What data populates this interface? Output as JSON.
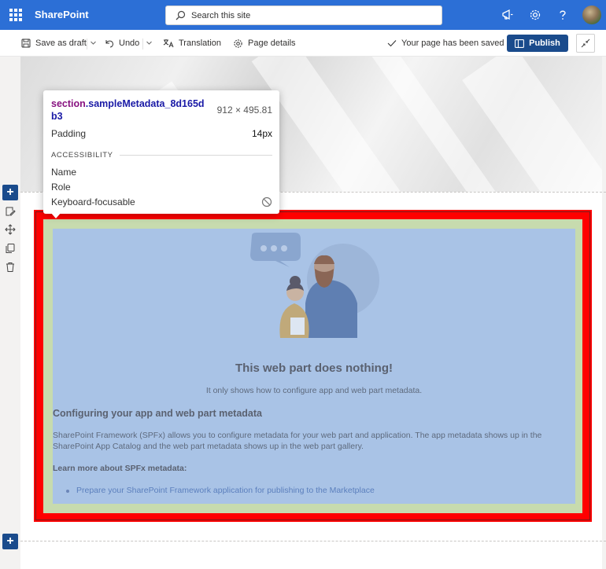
{
  "suite": {
    "app_name": "SharePoint",
    "search_placeholder": "Search this site"
  },
  "commands": {
    "save_draft": "Save as draft",
    "undo": "Undo",
    "translation": "Translation",
    "page_details": "Page details",
    "saved_status": "Your page has been saved",
    "publish": "Publish"
  },
  "tooltip": {
    "selector_tag": "section",
    "selector_class": ".sampleMetadata_8d165db3",
    "size": "912 × 495.81",
    "padding_label": "Padding",
    "padding_value": "14px",
    "section_title": "ACCESSIBILITY",
    "name_label": "Name",
    "role_label": "Role",
    "keyboard_label": "Keyboard-focusable"
  },
  "webpart": {
    "title": "This web part does nothing!",
    "subtitle": "It only shows how to configure app and web part metadata.",
    "heading": "Configuring your app and web part metadata",
    "paragraph": "SharePoint Framework (SPFx) allows you to configure metadata for your web part and application. The app metadata shows up in the SharePoint App Catalog and the web part metadata shows up in the web part gallery.",
    "learn_more": "Learn more about SPFx metadata:",
    "link": "Prepare your SharePoint Framework application for publishing to the Marketplace"
  },
  "colors": {
    "suite_bar": "#2c6fd6",
    "publish": "#1a4b8c",
    "margin_highlight": "#ff0000",
    "padding_highlight": "#c7dbae",
    "content_highlight": "#a9c3e6"
  }
}
